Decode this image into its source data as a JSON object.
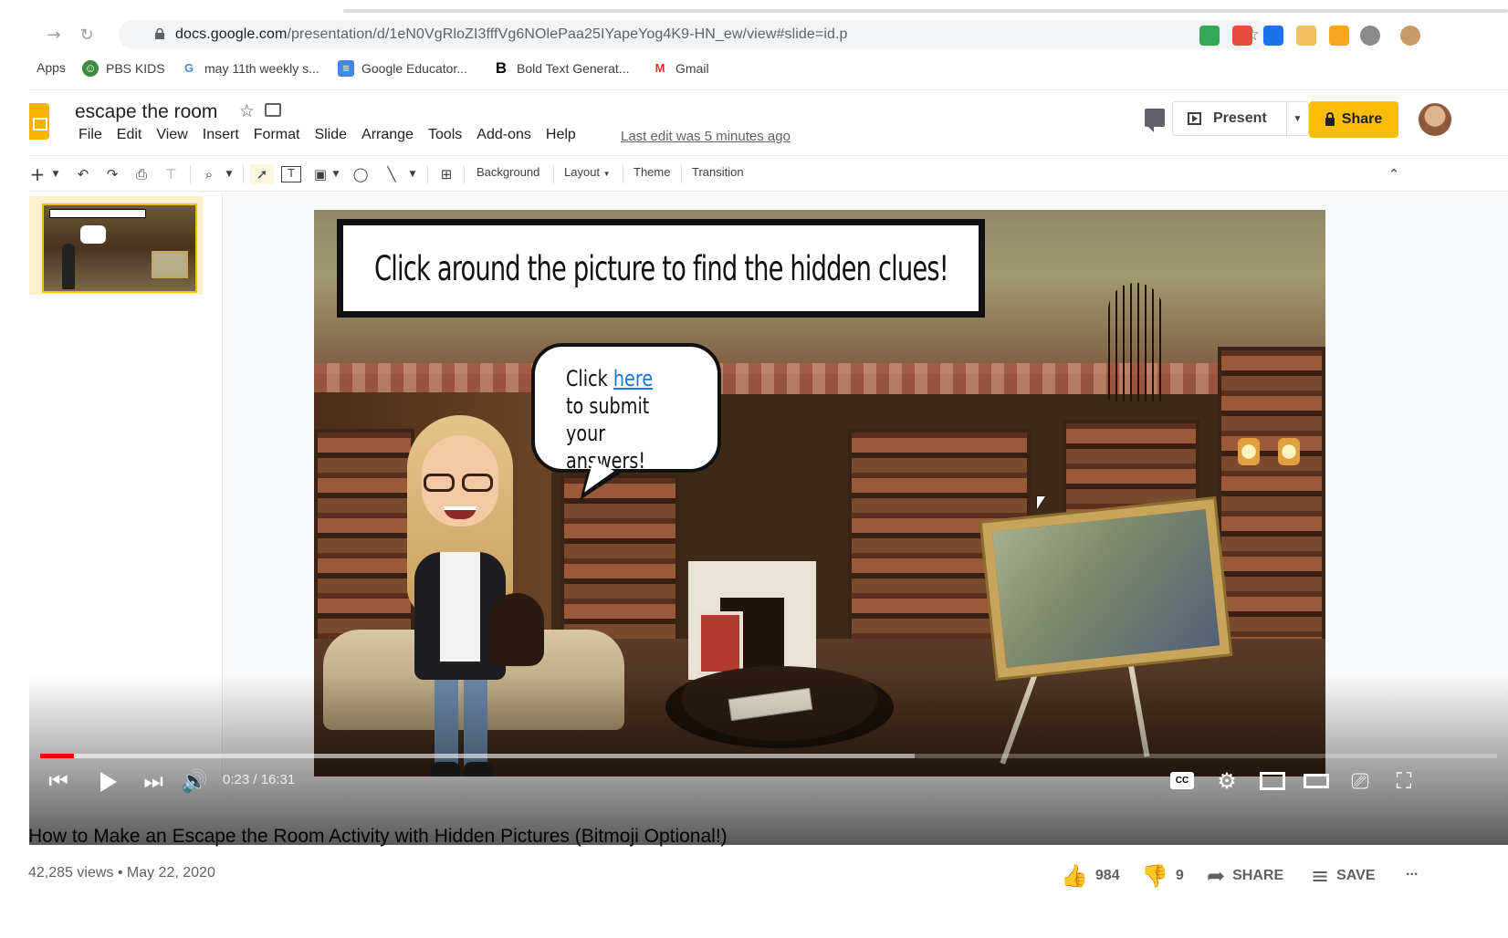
{
  "browser": {
    "url_host": "docs.google.com",
    "url_path": "/presentation/d/1eN0VgRloZI3fffVg6NOlePaa25IYapeYog4K9-HN_ew/view#slide=id.p",
    "bookmarks": [
      {
        "label": "Apps",
        "icon": "apps-grid-icon"
      },
      {
        "label": "PBS KIDS",
        "icon": "pbs-kids-icon"
      },
      {
        "label": "may 11th weekly s...",
        "icon": "google-icon"
      },
      {
        "label": "Google Educator...",
        "icon": "google-docs-icon"
      },
      {
        "label": "Bold Text Generat...",
        "icon": "bold-b-icon"
      },
      {
        "label": "Gmail",
        "icon": "gmail-icon"
      }
    ]
  },
  "slides_app": {
    "doc_title": "escape the room",
    "menu": [
      "File",
      "Edit",
      "View",
      "Insert",
      "Format",
      "Slide",
      "Arrange",
      "Tools",
      "Add-ons",
      "Help"
    ],
    "last_edit": "Last edit was 5 minutes ago",
    "present_label": "Present",
    "share_label": "Share",
    "toolbar": {
      "background": "Background",
      "layout": "Layout",
      "theme": "Theme",
      "transition": "Transition"
    },
    "accent_color": "#fbbc04"
  },
  "slide": {
    "title": "Click around the picture to find the hidden clues!",
    "bubble_pre": "Click ",
    "bubble_link": "here",
    "bubble_post": " to submit your answers!"
  },
  "player": {
    "time": "0:23 / 16:31",
    "played_fraction": 0.023,
    "loaded_fraction": 0.6
  },
  "video": {
    "title": "How to Make an Escape the Room Activity with Hidden Pictures (Bitmoji Optional!)",
    "meta": "42,285 views • May 22, 2020",
    "likes": "984",
    "dislikes": "9",
    "share_label": "SHARE",
    "save_label": "SAVE",
    "more_label": "..."
  }
}
